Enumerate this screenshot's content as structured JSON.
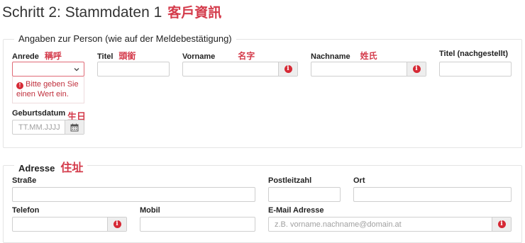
{
  "page": {
    "title": "Schritt 2: Stammdaten 1",
    "title_cjk": "客戶資訊"
  },
  "person": {
    "legend": "Angaben zur Person (wie auf der Meldebestätigung)",
    "anrede_label": "Anrede",
    "anrede_cjk": "稱呼",
    "anrede_error": "Bitte geben Sie einen Wert ein.",
    "titel_label": "Titel",
    "titel_cjk": "頭銜",
    "vorname_label": "Vorname",
    "vorname_cjk": "名字",
    "nachname_label": "Nachname",
    "nachname_cjk": "姓氏",
    "titel_nach_label": "Titel (nachgestellt)",
    "geburtsdatum_label": "Geburtsdatum",
    "geburtsdatum_cjk": "生日",
    "geburtsdatum_placeholder": "TT.MM.JJJJ"
  },
  "address": {
    "legend": "Adresse",
    "legend_cjk": "住址",
    "strasse_label": "Straße",
    "plz_label": "Postleitzahl",
    "ort_label": "Ort",
    "telefon_label": "Telefon",
    "mobil_label": "Mobil",
    "email_label": "E-Mail Adresse",
    "email_placeholder": "z.B. vorname.nachname@domain.at"
  },
  "icons": {
    "info": "info-circle-icon",
    "calendar": "calendar-icon",
    "error": "exclamation-circle-icon",
    "select": "chevron-down-icon"
  },
  "colors": {
    "annotation": "#d43b4b",
    "error": "#d62935"
  }
}
